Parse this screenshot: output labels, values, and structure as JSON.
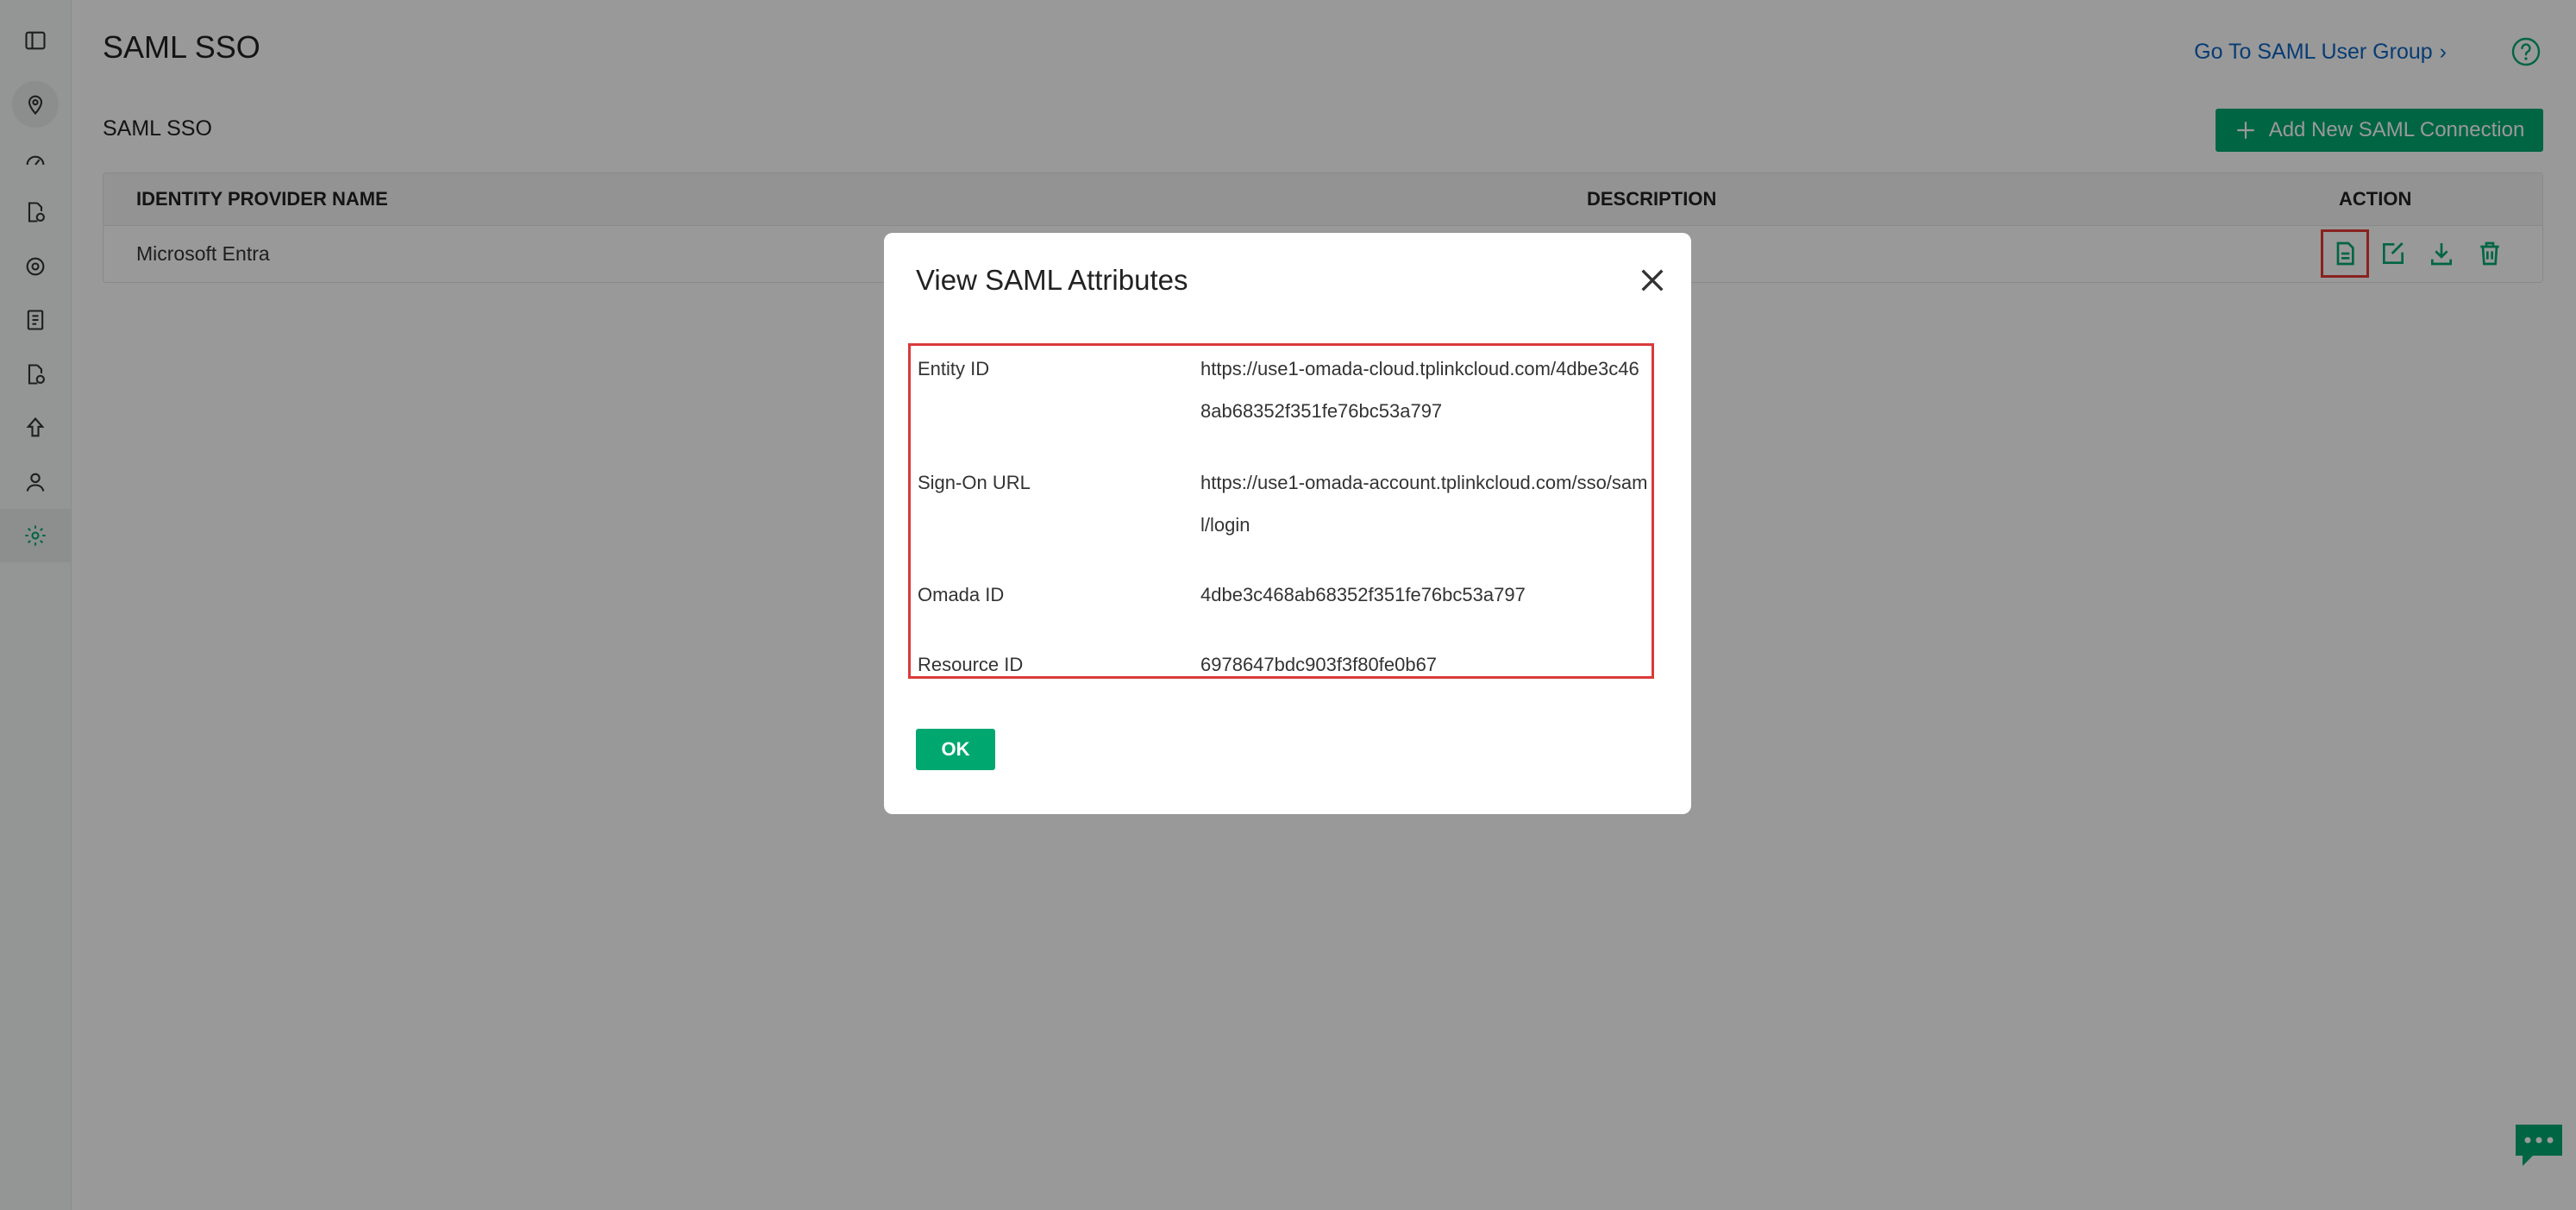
{
  "page": {
    "title": "SAML SSO",
    "go_to_group_label": "Go To SAML User Group",
    "section_title": "SAML SSO",
    "add_button_label": "Add New SAML Connection"
  },
  "table": {
    "headers": [
      "IDENTITY PROVIDER NAME",
      "DESCRIPTION",
      "ACTION"
    ],
    "rows": [
      {
        "name": "Microsoft Entra",
        "description": ""
      }
    ]
  },
  "modal": {
    "title": "View SAML Attributes",
    "ok_label": "OK",
    "attributes": [
      {
        "label": "Entity ID",
        "value": "https://use1-omada-cloud.tplinkcloud.com/4dbe3c468ab68352f351fe76bc53a797"
      },
      {
        "label": "Sign-On URL",
        "value": "https://use1-omada-account.tplinkcloud.com/sso/saml/login"
      },
      {
        "label": "Omada ID",
        "value": "4dbe3c468ab68352f351fe76bc53a797"
      },
      {
        "label": "Resource ID",
        "value": "6978647bdc903f3f80fe0b67"
      }
    ]
  },
  "colors": {
    "accent": "#00a870",
    "link": "#0c65c2",
    "highlight": "#d93a3a"
  },
  "icons": {
    "sidebar": [
      "sidebar-toggle-icon",
      "location-icon",
      "dashboard-icon",
      "report-icon",
      "target-icon",
      "log-icon",
      "audit-icon",
      "upgrade-icon",
      "user-icon",
      "settings-icon"
    ],
    "actions": [
      "view-document-icon",
      "edit-icon",
      "download-icon",
      "delete-icon"
    ]
  }
}
